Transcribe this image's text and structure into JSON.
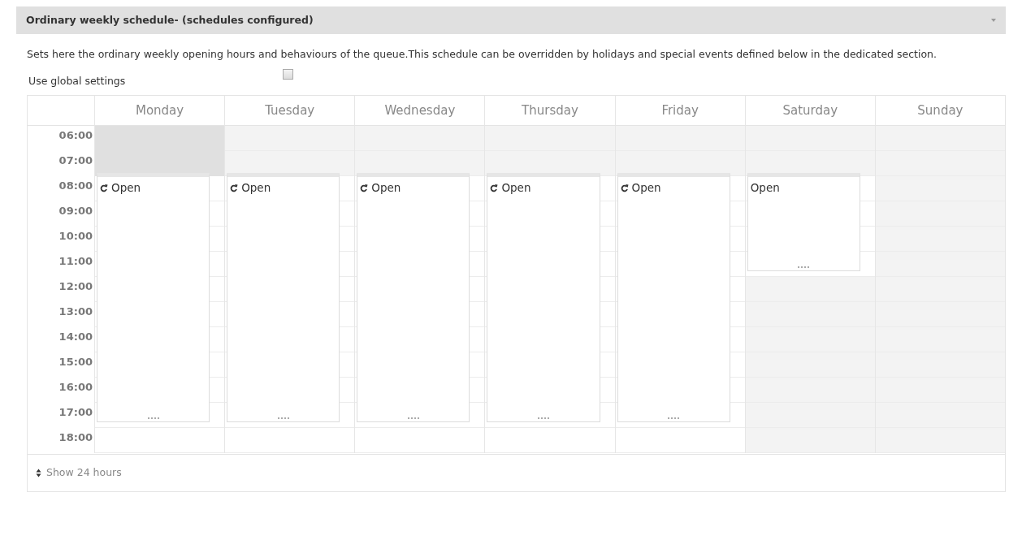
{
  "panel": {
    "title": "Ordinary weekly schedule- (schedules configured)",
    "expanded": true
  },
  "description": "Sets here the ordinary weekly opening hours and behaviours of the queue.This schedule can be overridden by holidays and special events defined below in the dedicated section.",
  "global_settings": {
    "label": "Use global settings",
    "checked": false
  },
  "calendar": {
    "hours": [
      "06:00",
      "07:00",
      "08:00",
      "09:00",
      "10:00",
      "11:00",
      "12:00",
      "13:00",
      "14:00",
      "15:00",
      "16:00",
      "17:00",
      "18:00"
    ],
    "days": [
      {
        "name": "Monday",
        "slots": [
          {
            "kind": "selected"
          },
          {
            "kind": "selected"
          },
          {
            "kind": "event"
          },
          {
            "kind": "event"
          },
          {
            "kind": "event"
          },
          {
            "kind": "event"
          },
          {
            "kind": "event"
          },
          {
            "kind": "event"
          },
          {
            "kind": "event"
          },
          {
            "kind": "event"
          },
          {
            "kind": "event"
          },
          {
            "kind": "event"
          },
          {
            "kind": "free"
          }
        ],
        "events": [
          {
            "label": "Open",
            "recurring": true
          }
        ]
      },
      {
        "name": "Tuesday",
        "slots": [
          {
            "kind": "closed"
          },
          {
            "kind": "closed"
          },
          {
            "kind": "event"
          },
          {
            "kind": "event"
          },
          {
            "kind": "event"
          },
          {
            "kind": "event"
          },
          {
            "kind": "event"
          },
          {
            "kind": "event"
          },
          {
            "kind": "event"
          },
          {
            "kind": "event"
          },
          {
            "kind": "event"
          },
          {
            "kind": "event"
          },
          {
            "kind": "free"
          }
        ],
        "events": [
          {
            "label": "Open",
            "recurring": true
          }
        ]
      },
      {
        "name": "Wednesday",
        "slots": [
          {
            "kind": "closed"
          },
          {
            "kind": "closed"
          },
          {
            "kind": "event"
          },
          {
            "kind": "event"
          },
          {
            "kind": "event"
          },
          {
            "kind": "event"
          },
          {
            "kind": "event"
          },
          {
            "kind": "event"
          },
          {
            "kind": "event"
          },
          {
            "kind": "event"
          },
          {
            "kind": "event"
          },
          {
            "kind": "event"
          },
          {
            "kind": "free"
          }
        ],
        "events": [
          {
            "label": "Open",
            "recurring": true
          }
        ]
      },
      {
        "name": "Thursday",
        "slots": [
          {
            "kind": "closed"
          },
          {
            "kind": "closed"
          },
          {
            "kind": "event"
          },
          {
            "kind": "event"
          },
          {
            "kind": "event"
          },
          {
            "kind": "event"
          },
          {
            "kind": "event"
          },
          {
            "kind": "event"
          },
          {
            "kind": "event"
          },
          {
            "kind": "event"
          },
          {
            "kind": "event"
          },
          {
            "kind": "event"
          },
          {
            "kind": "free"
          }
        ],
        "events": [
          {
            "label": "Open",
            "recurring": true
          }
        ]
      },
      {
        "name": "Friday",
        "slots": [
          {
            "kind": "closed"
          },
          {
            "kind": "closed"
          },
          {
            "kind": "event"
          },
          {
            "kind": "event"
          },
          {
            "kind": "event"
          },
          {
            "kind": "event"
          },
          {
            "kind": "event"
          },
          {
            "kind": "event"
          },
          {
            "kind": "event"
          },
          {
            "kind": "event"
          },
          {
            "kind": "event"
          },
          {
            "kind": "event"
          },
          {
            "kind": "free"
          }
        ],
        "events": [
          {
            "label": "Open",
            "recurring": true
          }
        ]
      },
      {
        "name": "Saturday",
        "slots": [
          {
            "kind": "closed"
          },
          {
            "kind": "closed"
          },
          {
            "kind": "event"
          },
          {
            "kind": "event"
          },
          {
            "kind": "event"
          },
          {
            "kind": "event"
          },
          {
            "kind": "closed"
          },
          {
            "kind": "closed"
          },
          {
            "kind": "closed"
          },
          {
            "kind": "closed"
          },
          {
            "kind": "closed"
          },
          {
            "kind": "closed"
          },
          {
            "kind": "closed"
          }
        ],
        "events": [
          {
            "label": "Open",
            "recurring": false
          }
        ]
      },
      {
        "name": "Sunday",
        "slots": [
          {
            "kind": "closed"
          },
          {
            "kind": "closed"
          },
          {
            "kind": "closed"
          },
          {
            "kind": "closed"
          },
          {
            "kind": "closed"
          },
          {
            "kind": "closed"
          },
          {
            "kind": "closed"
          },
          {
            "kind": "closed"
          },
          {
            "kind": "closed"
          },
          {
            "kind": "closed"
          },
          {
            "kind": "closed"
          },
          {
            "kind": "closed"
          },
          {
            "kind": "closed"
          }
        ]
      }
    ]
  },
  "footer": {
    "label": "Show 24 hours"
  }
}
